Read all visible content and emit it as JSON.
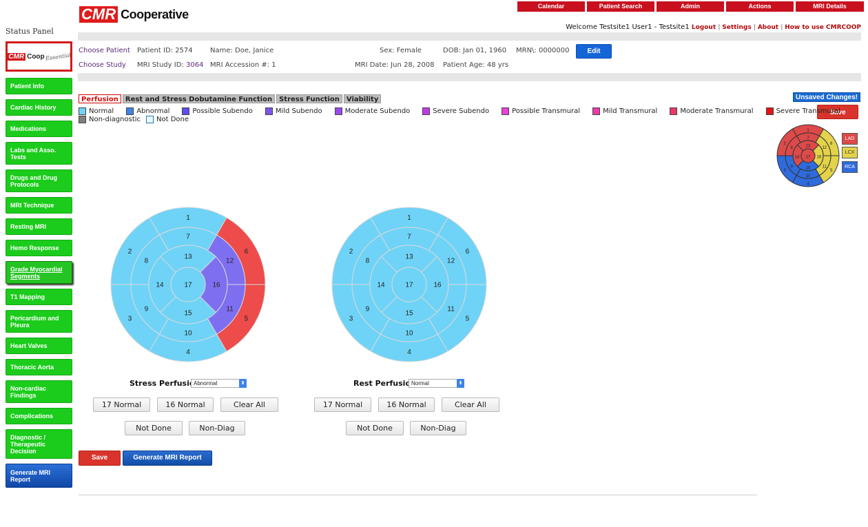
{
  "brand": {
    "logo_red": "CMR",
    "logo_text": "Cooperative"
  },
  "top_nav": [
    "Calendar",
    "Patient Search",
    "Admin",
    "Actions",
    "MRI Details"
  ],
  "welcome": {
    "text": "Welcome Testsite1 User1 - Testsite1",
    "links": [
      "Logout",
      "Settings",
      "About",
      "How to use CMRCOOP"
    ]
  },
  "sidebar": {
    "title": "Status Panel",
    "logo": {
      "cmr": "CMR",
      "coop": "Coop",
      "essential": "Essential"
    },
    "items": [
      "Patient Info",
      "Cardiac History",
      "Medications",
      "Labs and Asso. Tests",
      "Drugs and Drug Protocols",
      "MRI Technique",
      "Resting MRI",
      "Hemo Response",
      "Grade Myocardial Segments",
      "T1 Mapping",
      "Pericardium and Pleura",
      "Heart Valves",
      "Thoracic Aorta",
      "Non-cardiac Findings",
      "Complications",
      "Diagnostic / Therapeutic Decision",
      "Generate MRI Report"
    ],
    "active_index": 8
  },
  "patient": {
    "choose_patient": "Choose Patient",
    "patient_id": "Patient ID: 2574",
    "name": "Name: Doe, Janice",
    "sex": "Sex: Female",
    "dob": "DOB: Jan 01, 1960",
    "mrn": "MRN\\: 0000000",
    "edit": "Edit",
    "choose_study": "Choose Study",
    "mri_study_id_label": "MRI Study ID:",
    "mri_study_id": "3064",
    "accession": "MRI Accession #: 1",
    "mri_date": "MRI Date: Jun 28, 2008",
    "age": "Patient Age: 48 yrs"
  },
  "tabs": [
    "Perfusion",
    "Rest and Stress Dobutamine Function",
    "Stress Function",
    "Viability"
  ],
  "active_tab": 0,
  "unsaved": "Unsaved Changes!",
  "save": "Save",
  "legend": [
    {
      "label": "Normal",
      "color": "#6fd3f7"
    },
    {
      "label": "Abnormal",
      "color": "#3b84e8"
    },
    {
      "label": "Possible Subendo",
      "color": "#5b4df0"
    },
    {
      "label": "Mild Subendo",
      "color": "#7a56ea"
    },
    {
      "label": "Moderate Subendo",
      "color": "#9a48ee"
    },
    {
      "label": "Severe Subendo",
      "color": "#c23be8"
    },
    {
      "label": "Possible Transmural",
      "color": "#ea40d8"
    },
    {
      "label": "Mild Transmural",
      "color": "#ee3aa6"
    },
    {
      "label": "Moderate Transmural",
      "color": "#ec3568"
    },
    {
      "label": "Severe Transmural",
      "color": "#e81010"
    },
    {
      "label": "Non-diagnostic",
      "color": "#808080"
    },
    {
      "label": "Not Done",
      "color": "#eaf8fc"
    }
  ],
  "artery_map": {
    "labels": [
      "LAD",
      "LCX",
      "RCA"
    ],
    "colors": {
      "LAD": "#dd4a4a",
      "LCX": "#e3d34a",
      "RCA": "#2f6bdc"
    }
  },
  "stress": {
    "label": "Stress Perfusion:",
    "value": "Abnormal",
    "segments": {
      "1": "#6fd3f7",
      "2": "#6fd3f7",
      "3": "#6fd3f7",
      "4": "#6fd3f7",
      "5": "#ee4b4b",
      "6": "#ee4b4b",
      "7": "#6fd3f7",
      "8": "#6fd3f7",
      "9": "#6fd3f7",
      "10": "#6fd3f7",
      "11": "#7e6ff0",
      "12": "#7e6ff0",
      "13": "#6fd3f7",
      "14": "#6fd3f7",
      "15": "#6fd3f7",
      "16": "#7e6ff0",
      "17": "#6fd3f7"
    },
    "btn_17": "17 Normal",
    "btn_16": "16 Normal",
    "btn_clear": "Clear All",
    "btn_notdone": "Not Done",
    "btn_nondiag": "Non-Diag"
  },
  "rest": {
    "label": "Rest Perfusion:",
    "value": "Normal",
    "segments": {
      "1": "#6fd3f7",
      "2": "#6fd3f7",
      "3": "#6fd3f7",
      "4": "#6fd3f7",
      "5": "#6fd3f7",
      "6": "#6fd3f7",
      "7": "#6fd3f7",
      "8": "#6fd3f7",
      "9": "#6fd3f7",
      "10": "#6fd3f7",
      "11": "#6fd3f7",
      "12": "#6fd3f7",
      "13": "#6fd3f7",
      "14": "#6fd3f7",
      "15": "#6fd3f7",
      "16": "#6fd3f7",
      "17": "#6fd3f7"
    },
    "btn_17": "17 Normal",
    "btn_16": "16 Normal",
    "btn_clear": "Clear All",
    "btn_notdone": "Not Done",
    "btn_nondiag": "Non-Diag"
  },
  "bottom": {
    "save": "Save",
    "report": "Generate MRI Report"
  }
}
